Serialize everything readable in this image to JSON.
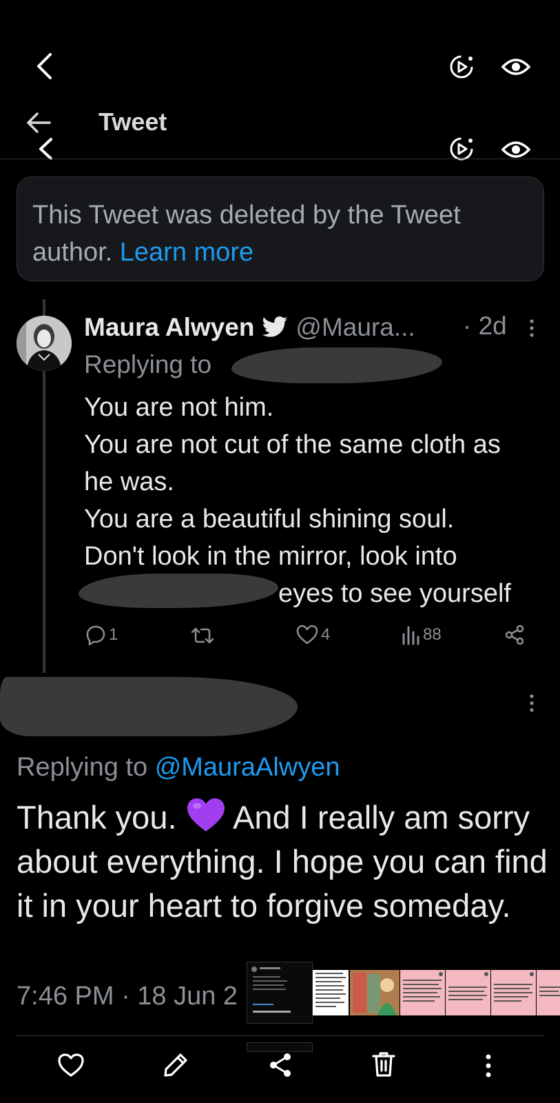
{
  "header": {
    "title": "Tweet"
  },
  "deleted_notice": {
    "text": "This Tweet was deleted by the Tweet author.",
    "link": "Learn more"
  },
  "reply_tweet": {
    "name": "Maura Alwyen",
    "handle": "@Maura...",
    "time": "· 2d",
    "replying_to_label": "Replying to",
    "lines": [
      "You are not him.",
      "You are not cut of the same cloth as",
      "he was.",
      "You are a beautiful shining soul.",
      "Don't look in the mirror, look into",
      "eyes to see yourself"
    ],
    "stats": {
      "replies": "1",
      "likes": "4",
      "views": "88"
    }
  },
  "main_tweet": {
    "replying_to_label": "Replying to",
    "replying_to_handle": "@MauraAlwyen",
    "text_part1": "Thank you.",
    "text_part2": "And I really am sorry about everything. I hope you can find it in your heart to forgive someday.",
    "timestamp": "7:46 PM · 18 Jun 2"
  },
  "icons": [
    "back-chevron-icon",
    "live-replay-icon",
    "eye-icon",
    "back-arrow-icon",
    "verified-bird-icon",
    "more-vertical-icon",
    "reply-icon",
    "retweet-icon",
    "like-icon",
    "views-icon",
    "share-icon",
    "heart-icon",
    "edit-pencil-icon",
    "trash-icon"
  ],
  "colors": {
    "background": "#000000",
    "link": "#1d9bf0",
    "muted": "#8b9096",
    "text": "#e7e9ea",
    "heart_emoji": "#a13ff0"
  }
}
